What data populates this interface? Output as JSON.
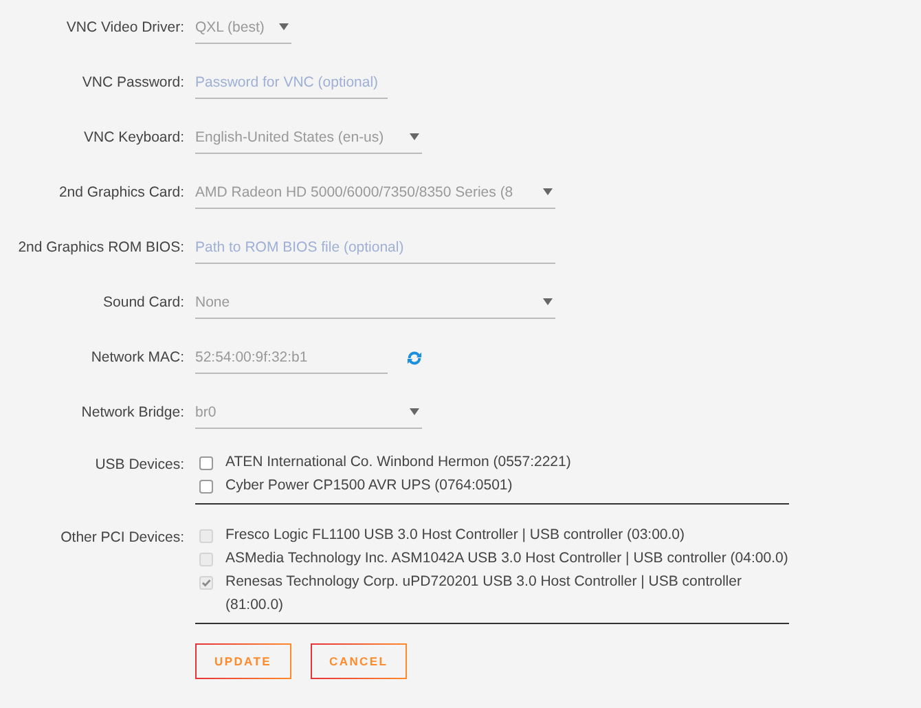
{
  "fields": [
    {
      "label": "VNC Video Driver:",
      "kind": "select",
      "value": "QXL (best)"
    },
    {
      "label": "VNC Password:",
      "kind": "text",
      "placeholder": "Password for VNC (optional)"
    },
    {
      "label": "VNC Keyboard:",
      "kind": "select",
      "value": "English-United States (en-us)"
    },
    {
      "label": "2nd Graphics Card:",
      "kind": "select",
      "value": "AMD Radeon HD 5000/6000/7350/8350 Series (8"
    },
    {
      "label": "2nd Graphics ROM BIOS:",
      "kind": "text",
      "placeholder": "Path to ROM BIOS file (optional)"
    },
    {
      "label": "Sound Card:",
      "kind": "select",
      "value": "None"
    },
    {
      "label": "Network MAC:",
      "kind": "text",
      "value": "52:54:00:9f:32:b1",
      "refresh": true
    },
    {
      "label": "Network Bridge:",
      "kind": "select",
      "value": "br0"
    }
  ],
  "device_lists": [
    {
      "label": "USB Devices:",
      "items": [
        {
          "name": "ATEN International Co. Winbond Hermon (0557:2221)",
          "checked": false,
          "disabled": false
        },
        {
          "name": "Cyber Power CP1500 AVR UPS (0764:0501)",
          "checked": false,
          "disabled": false
        }
      ]
    },
    {
      "label": "Other PCI Devices:",
      "items": [
        {
          "name": "Fresco Logic FL1100 USB 3.0 Host Controller | USB controller (03:00.0)",
          "checked": false,
          "disabled": true
        },
        {
          "name": "ASMedia Technology Inc. ASM1042A USB 3.0 Host Controller | USB controller (04:00.0)",
          "checked": false,
          "disabled": true
        },
        {
          "name": "Renesas Technology Corp. uPD720201 USB 3.0 Host Controller | USB controller (81:00.0)",
          "checked": true,
          "disabled": true
        }
      ]
    }
  ],
  "buttons": [
    "UPDATE",
    "CANCEL"
  ]
}
